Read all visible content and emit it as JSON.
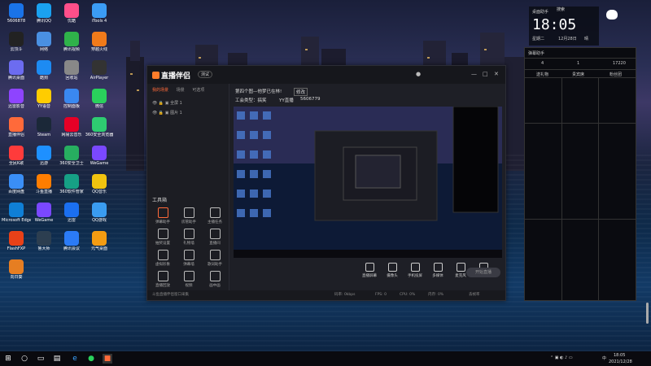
{
  "desktop": {
    "icons": [
      {
        "label": "5606878",
        "color": "#1a73e8"
      },
      {
        "label": "腾讯QQ",
        "color": "#1aa1f0"
      },
      {
        "label": "优酷",
        "color": "#ff4f8a"
      },
      {
        "label": "iTools 4",
        "color": "#3b9cf5"
      },
      {
        "label": "云顶斗",
        "color": "#222"
      },
      {
        "label": "网络",
        "color": "#4a90e2"
      },
      {
        "label": "腾讯视频",
        "color": "#2fb24a"
      },
      {
        "label": "穿越火线",
        "color": "#f07a1a"
      },
      {
        "label": "腾讯桌面",
        "color": "#6c6cf0"
      },
      {
        "label": "酷狗",
        "color": "#1d8bf2"
      },
      {
        "label": "回收站",
        "color": "#888"
      },
      {
        "label": "AirPlayer",
        "color": "#333"
      },
      {
        "label": "迅雷影音",
        "color": "#8e44ff"
      },
      {
        "label": "YY语音",
        "color": "#ffcc00"
      },
      {
        "label": "控制面板",
        "color": "#3a88f0"
      },
      {
        "label": "微信",
        "color": "#2ad15c"
      },
      {
        "label": "直播伴侣",
        "color": "#ff6a3a"
      },
      {
        "label": "Steam",
        "color": "#1b2838"
      },
      {
        "label": "网易云音乐",
        "color": "#e60026"
      },
      {
        "label": "360安全浏览器",
        "color": "#2ecc71"
      },
      {
        "label": "全民K歌",
        "color": "#ff3b3b"
      },
      {
        "label": "迅游",
        "color": "#1e90ff"
      },
      {
        "label": "360安全卫士",
        "color": "#27ae60"
      },
      {
        "label": "WeGame",
        "color": "#7a48ff"
      },
      {
        "label": "百度网盘",
        "color": "#3a8ef6"
      },
      {
        "label": "斗鱼直播",
        "color": "#ff7d00"
      },
      {
        "label": "360软件管家",
        "color": "#16a085"
      },
      {
        "label": "QQ音乐",
        "color": "#f1c40f"
      },
      {
        "label": "Microsoft Edge",
        "color": "#0f7fd6"
      },
      {
        "label": "WeGame",
        "color": "#7a48ff"
      },
      {
        "label": "迅雷",
        "color": "#1b6ff0"
      },
      {
        "label": "QQ游戏",
        "color": "#3a9cf0"
      },
      {
        "label": "FlashFXP",
        "color": "#e84118"
      },
      {
        "label": "鲁大师",
        "color": "#2c3e50"
      },
      {
        "label": "腾讯会议",
        "color": "#2b7bf6"
      },
      {
        "label": "元气桌面",
        "color": "#f39c12"
      },
      {
        "label": "向日葵",
        "color": "#e67e22"
      }
    ]
  },
  "app": {
    "logo": "直播伴侣",
    "version": "测试",
    "left_tabs": [
      "我的场景",
      "场景",
      "可选项"
    ],
    "sources": [
      "全屏 1",
      "图片 1"
    ],
    "tools_header": "工具箱",
    "tools": [
      "弹幕助手",
      "房管助手",
      "主播任务",
      "抽奖设置",
      "礼物墙",
      "直播间",
      "虚拟形象",
      "弹幕墙",
      "歌词助手",
      "直播回放",
      "视频",
      "画中画"
    ],
    "room_title": "第四个图—他梦已在林!",
    "room_tag": "修改",
    "room_meta": [
      "工会类型：搞笑",
      "YY直播",
      "5606779"
    ],
    "bottom_buttons": [
      "直播屏幕",
      "摄像头",
      "手机投屏",
      "多媒体",
      "麦克风",
      "扬声器"
    ],
    "start_live": "开始直播",
    "status_left": "斗鱼直播伴侣窗口采集",
    "status_right": [
      "码率: 0kbps",
      "FPS: 0",
      "CPU: 0%",
      "内存: 0%",
      "丢帧率"
    ],
    "close_glyph": "✕",
    "min_glyph": "—",
    "max_glyph": "□"
  },
  "widgets": {
    "clock_title": "桌面助手",
    "clock_time": "18:05",
    "clock_date": "12月28日",
    "clock_weekday": "星期二",
    "clock_weather": "晴",
    "top_label": "搜索",
    "panel_title": "弹幕助手",
    "panel_stats": [
      "4",
      "1",
      "17220"
    ],
    "panel_cols": [
      "送礼物",
      "贵宾席",
      "粉丝团"
    ]
  },
  "taskbar": {
    "clock_time": "18:05",
    "clock_date": "2021/12/28",
    "lang": "中"
  }
}
